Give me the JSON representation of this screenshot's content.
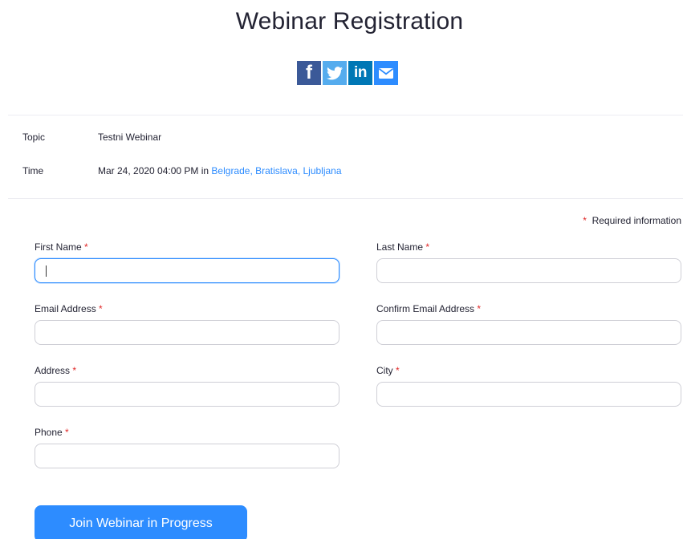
{
  "page": {
    "title": "Webinar Registration"
  },
  "share": {
    "facebook": {
      "icon": "facebook-icon",
      "glyph": "f",
      "color": "#3b5998"
    },
    "twitter": {
      "icon": "twitter-icon",
      "color": "#55acee"
    },
    "linkedin": {
      "icon": "linkedin-icon",
      "glyph": "in",
      "color": "#0077b5"
    },
    "email": {
      "icon": "email-icon",
      "color": "#2d8cff"
    }
  },
  "info": {
    "topic_label": "Topic",
    "topic_value": "Testni Webinar",
    "time_label": "Time",
    "time_value": "Mar 24, 2020 04:00 PM in ",
    "timezone": "Belgrade, Bratislava, Ljubljana"
  },
  "form": {
    "required_star": "*",
    "required_note": "Required information",
    "first_name_label": "First Name",
    "last_name_label": "Last Name",
    "email_label": "Email Address",
    "confirm_email_label": "Confirm Email Address",
    "address_label": "Address",
    "city_label": "City",
    "phone_label": "Phone",
    "submit_label": "Join Webinar in Progress"
  },
  "colors": {
    "accent": "#2d8cff",
    "required": "#e02828"
  }
}
